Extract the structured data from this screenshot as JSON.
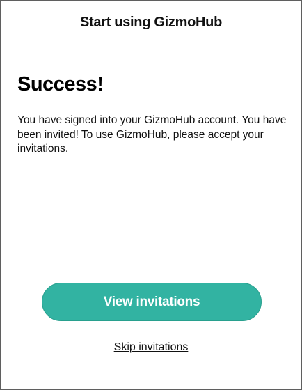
{
  "header": {
    "title": "Start using GizmoHub"
  },
  "main": {
    "heading": "Success!",
    "message": "You have signed into your GizmoHub account. You have been invited! To use GizmoHub, please accept your invitations."
  },
  "actions": {
    "view_label": "View invitations",
    "skip_label": "Skip invitations"
  },
  "colors": {
    "accent": "#32b3a2",
    "text": "#111111",
    "background": "#ffffff"
  }
}
